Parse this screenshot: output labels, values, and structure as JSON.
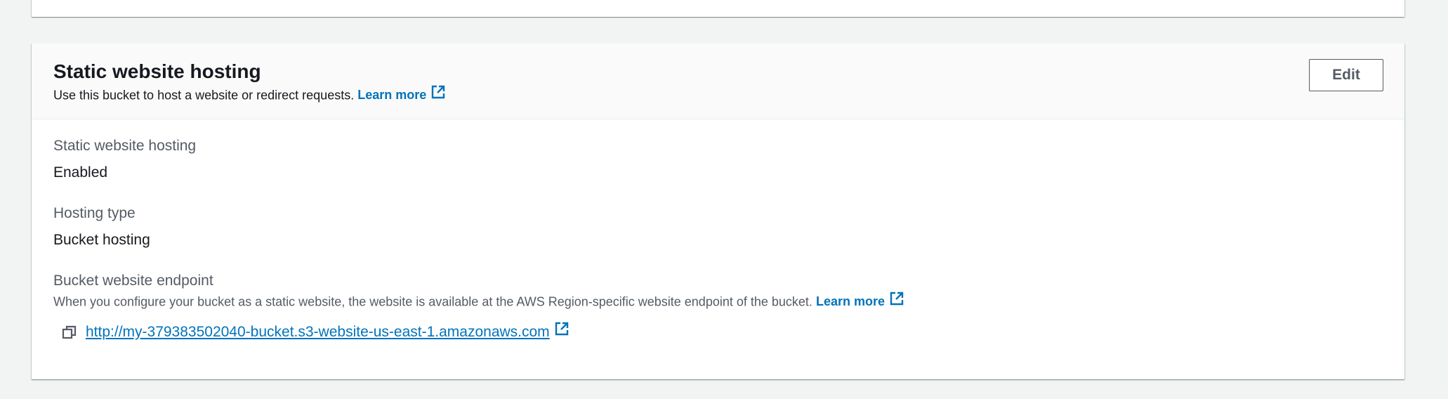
{
  "section": {
    "title": "Static website hosting",
    "description": "Use this bucket to host a website or redirect requests.",
    "learn_more": "Learn more",
    "edit_label": "Edit"
  },
  "fields": {
    "hosting": {
      "label": "Static website hosting",
      "value": "Enabled"
    },
    "hosting_type": {
      "label": "Hosting type",
      "value": "Bucket hosting"
    },
    "endpoint": {
      "label": "Bucket website endpoint",
      "description": "When you configure your bucket as a static website, the website is available at the AWS Region-specific website endpoint of the bucket.",
      "learn_more": "Learn more",
      "url": "http://my-379383502040-bucket.s3-website-us-east-1.amazonaws.com"
    }
  },
  "icons": {
    "external_link": "external-link-icon",
    "copy": "copy-icon"
  },
  "colors": {
    "link": "#0073bb",
    "page_background": "#f2f3f3",
    "header_background": "#fafafa"
  }
}
